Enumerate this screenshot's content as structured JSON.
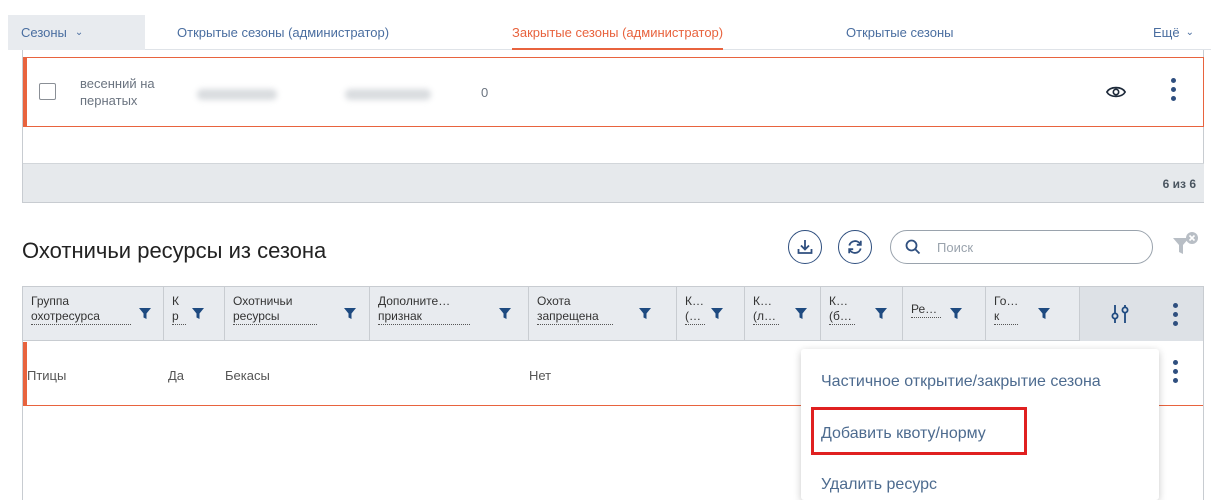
{
  "tabs": {
    "dropdown_label": "Сезоны",
    "items": [
      {
        "label": "Открытые сезоны (администратор)"
      },
      {
        "label": "Закрытые сезоны (администратор)"
      },
      {
        "label": "Открытые сезоны"
      }
    ],
    "more_label": "Ещё"
  },
  "seasons_table": {
    "row": {
      "name": "весенний на пернатых",
      "count": "0"
    },
    "footer_count": "6 из 6"
  },
  "resources": {
    "title": "Охотничьи ресурсы из сезона",
    "search_placeholder": "Поиск",
    "columns": [
      {
        "label": "Группа охотресурса"
      },
      {
        "label": "К р"
      },
      {
        "label": "Охотничьи ресурсы"
      },
      {
        "label": "Дополните… признак"
      },
      {
        "label": "Охота запрещена"
      },
      {
        "label": "К… (…"
      },
      {
        "label": "К… (л…"
      },
      {
        "label": "К… (б…"
      },
      {
        "label": "Ре…"
      },
      {
        "label": "Го… к"
      }
    ],
    "rows": [
      {
        "group": "Птицы",
        "k": "Да",
        "resource": "Бекасы",
        "banned": "Нет"
      }
    ]
  },
  "context_menu": {
    "items": [
      {
        "label": "Частичное открытие/закрытие сезона"
      },
      {
        "label": "Добавить квоту/норму"
      },
      {
        "label": "Удалить ресурс"
      }
    ]
  },
  "colors": {
    "accent": "#e8633e",
    "link": "#4a6ea0",
    "highlight": "#e02020"
  }
}
